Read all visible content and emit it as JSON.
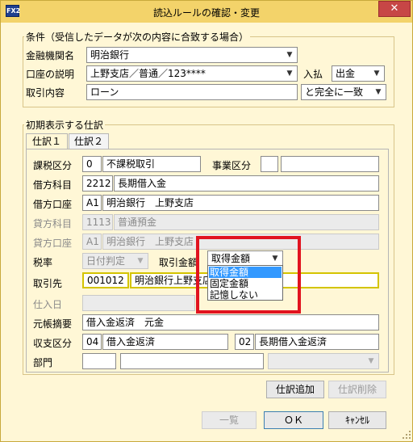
{
  "window": {
    "title": "読込ルールの確認・変更",
    "app_icon": "FX2",
    "close_label": "✕"
  },
  "conditions": {
    "legend": "条件（受信したデータが次の内容に合致する場合）",
    "bank_label": "金融機関名",
    "bank_value": "明治銀行",
    "account_label": "口座の説明",
    "account_value": "上野支店／普通／123****",
    "in_out_label": "入払",
    "in_out_value": "出金",
    "transaction_label": "取引内容",
    "transaction_value": "ローン",
    "match_value": "と完全に一致"
  },
  "journal": {
    "legend": "初期表示する仕訳",
    "tabs": [
      "仕訳１",
      "仕訳２"
    ],
    "tax_category_label": "課税区分",
    "tax_category_code": "0",
    "tax_category_name": "不課税取引",
    "business_category_label": "事業区分",
    "debit_account_label": "借方科目",
    "debit_account_code": "2212",
    "debit_account_name": "長期借入金",
    "debit_bank_label": "借方口座",
    "debit_bank_code": "A1",
    "debit_bank_name": "明治銀行　上野支店",
    "credit_account_label": "貸方科目",
    "credit_account_code": "1113",
    "credit_account_name": "普通預金",
    "credit_bank_label": "貸方口座",
    "credit_bank_code": "A1",
    "credit_bank_name": "明治銀行　上野支店",
    "tax_rate_label": "税率",
    "tax_rate_value": "日付判定",
    "amount_label": "取引金額",
    "amount_value": "取得金額",
    "amount_options": [
      "取得金額",
      "固定金額",
      "記憶しない"
    ],
    "partner_label": "取引先",
    "partner_code": "001012",
    "partner_name": "明治銀行上野支店",
    "purchase_label": "仕入日",
    "summary_label": "元帳摘要",
    "summary_value": "借入金返済　元金",
    "income_category_label": "収支区分",
    "income_code_1": "04",
    "income_name_1": "借入金返済",
    "income_code_2": "02",
    "income_name_2": "長期借入金返済",
    "department_label": "部門"
  },
  "buttons": {
    "add_entry": "仕訳追加",
    "delete_entry": "仕訳削除",
    "list": "一覧",
    "ok": "ＯＫ",
    "cancel": "ｷｬﾝｾﾙ"
  },
  "colors": {
    "accent": "#f3d36a",
    "background": "#fff7d6",
    "highlight": "#e1131f",
    "selection": "#3399ff"
  }
}
